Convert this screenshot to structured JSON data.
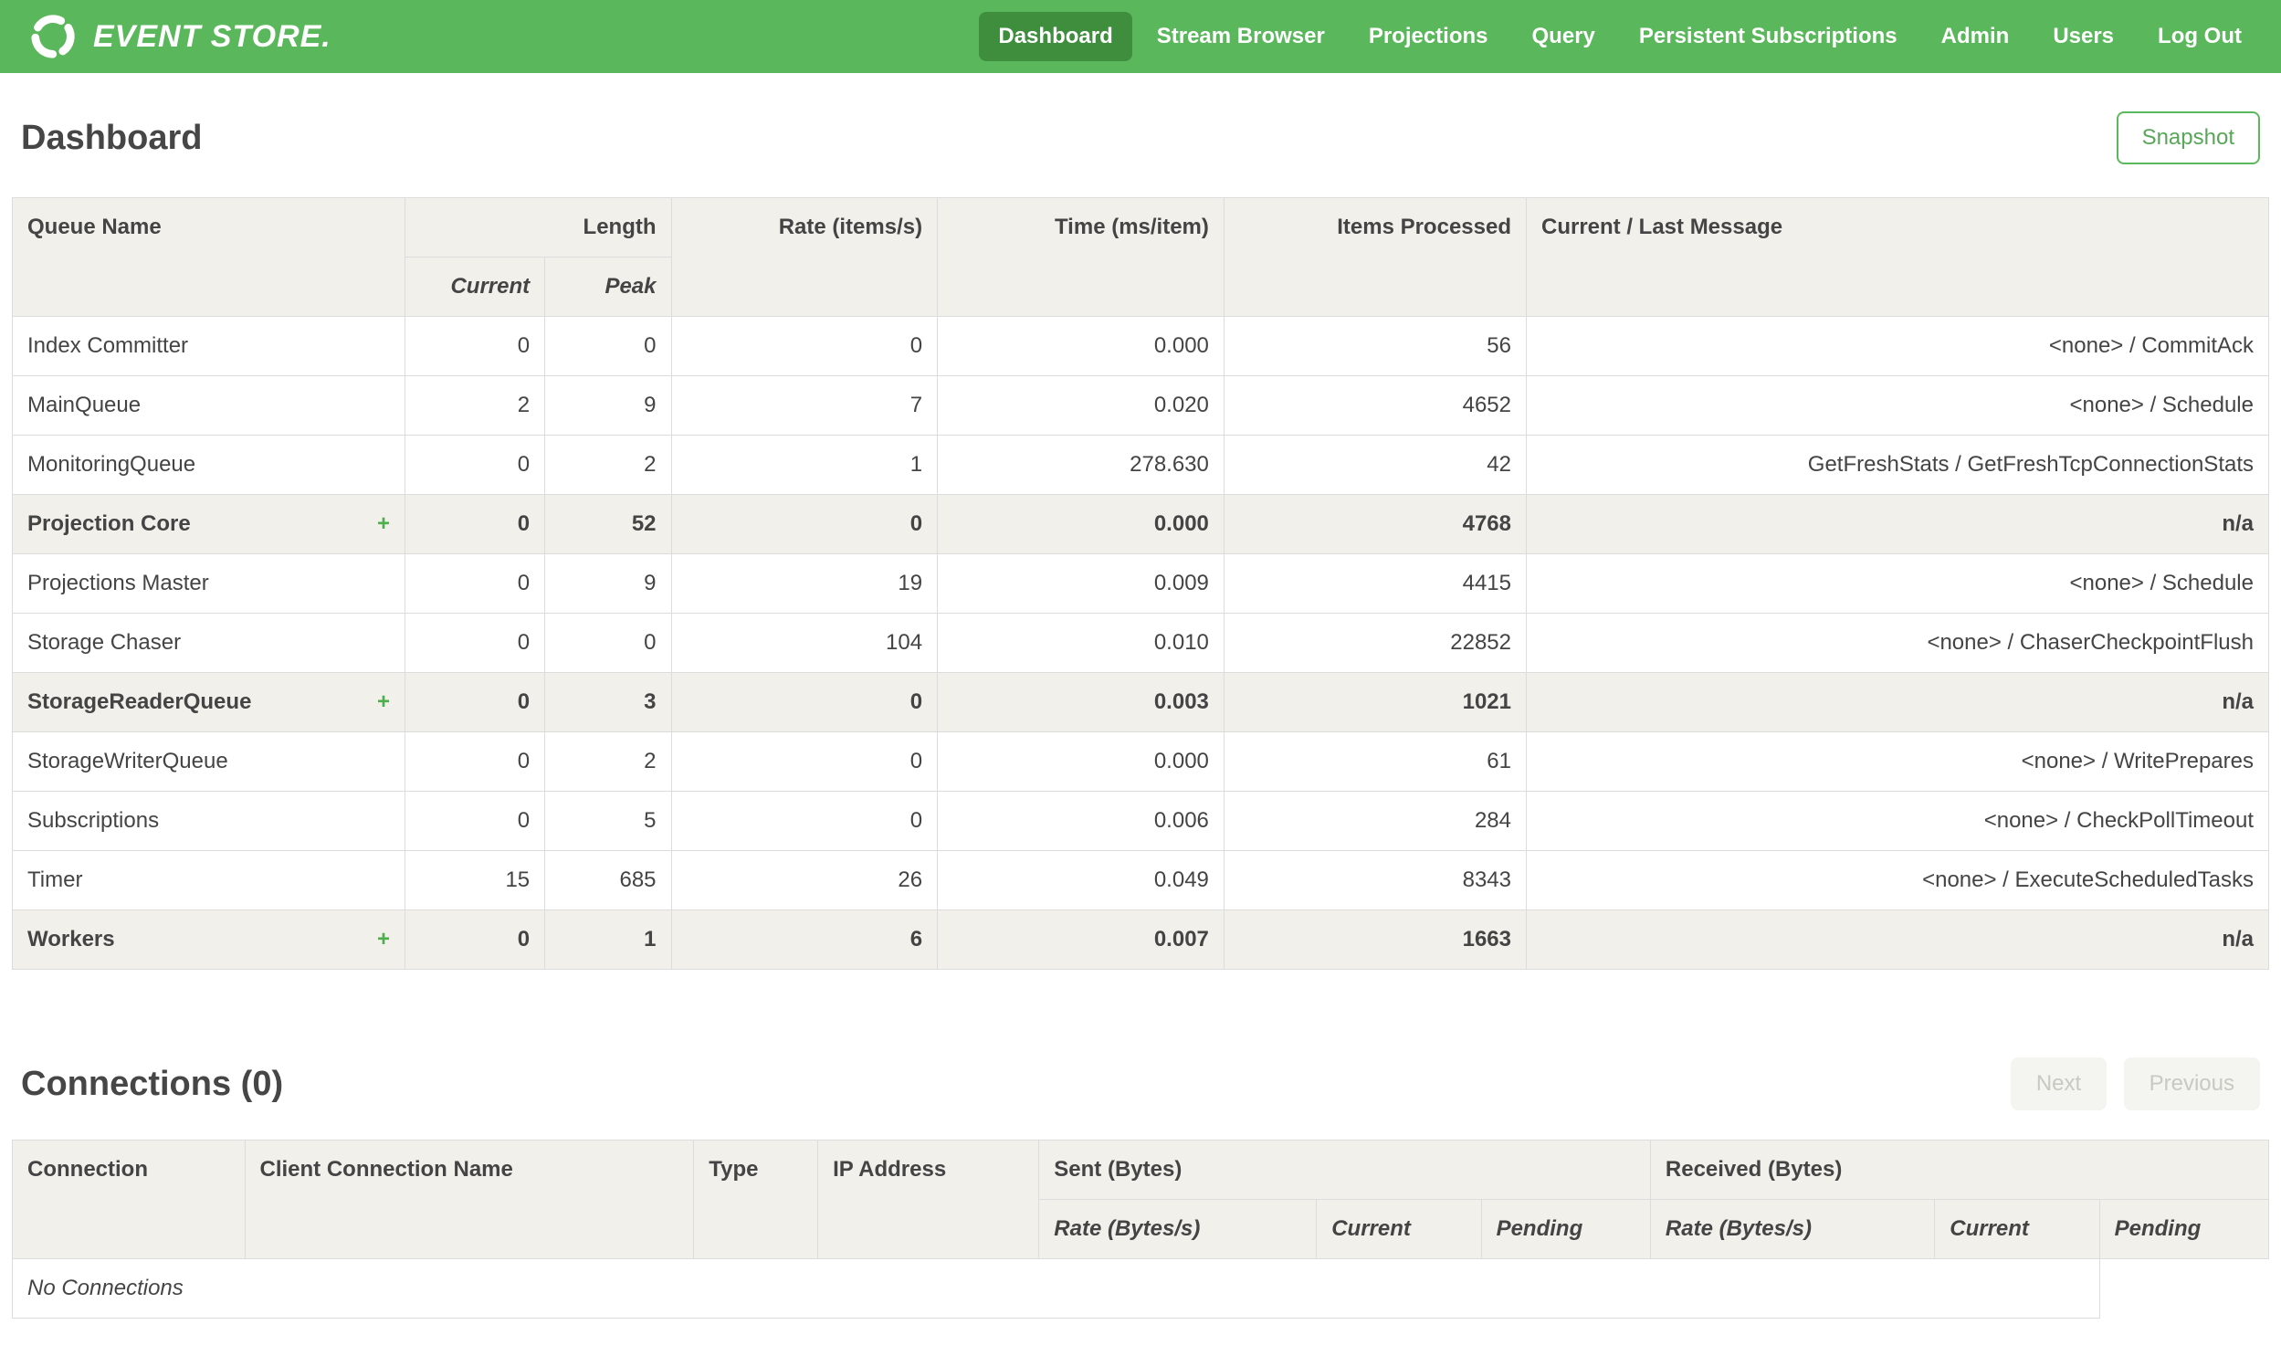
{
  "navbar": {
    "brand": "EVENT STORE.",
    "items": [
      {
        "label": "Dashboard",
        "active": true
      },
      {
        "label": "Stream Browser",
        "active": false
      },
      {
        "label": "Projections",
        "active": false
      },
      {
        "label": "Query",
        "active": false
      },
      {
        "label": "Persistent Subscriptions",
        "active": false
      },
      {
        "label": "Admin",
        "active": false
      },
      {
        "label": "Users",
        "active": false
      },
      {
        "label": "Log Out",
        "active": false
      }
    ]
  },
  "page": {
    "title": "Dashboard",
    "snapshot_button": "Snapshot"
  },
  "queues": {
    "headers": {
      "queue_name": "Queue Name",
      "length": "Length",
      "current": "Current",
      "peak": "Peak",
      "rate": "Rate (items/s)",
      "time": "Time (ms/item)",
      "items_processed": "Items Processed",
      "message": "Current / Last Message"
    },
    "rows": [
      {
        "name": "Index Committer",
        "expandable": false,
        "current": "0",
        "peak": "0",
        "rate": "0",
        "time": "0.000",
        "items_processed": "56",
        "message": "<none> / CommitAck"
      },
      {
        "name": "MainQueue",
        "expandable": false,
        "current": "2",
        "peak": "9",
        "rate": "7",
        "time": "0.020",
        "items_processed": "4652",
        "message": "<none> / Schedule"
      },
      {
        "name": "MonitoringQueue",
        "expandable": false,
        "current": "0",
        "peak": "2",
        "rate": "1",
        "time": "278.630",
        "items_processed": "42",
        "message": "GetFreshStats / GetFreshTcpConnectionStats"
      },
      {
        "name": "Projection Core",
        "expandable": true,
        "current": "0",
        "peak": "52",
        "rate": "0",
        "time": "0.000",
        "items_processed": "4768",
        "message": "n/a"
      },
      {
        "name": "Projections Master",
        "expandable": false,
        "current": "0",
        "peak": "9",
        "rate": "19",
        "time": "0.009",
        "items_processed": "4415",
        "message": "<none> / Schedule"
      },
      {
        "name": "Storage Chaser",
        "expandable": false,
        "current": "0",
        "peak": "0",
        "rate": "104",
        "time": "0.010",
        "items_processed": "22852",
        "message": "<none> / ChaserCheckpointFlush"
      },
      {
        "name": "StorageReaderQueue",
        "expandable": true,
        "current": "0",
        "peak": "3",
        "rate": "0",
        "time": "0.003",
        "items_processed": "1021",
        "message": "n/a"
      },
      {
        "name": "StorageWriterQueue",
        "expandable": false,
        "current": "0",
        "peak": "2",
        "rate": "0",
        "time": "0.000",
        "items_processed": "61",
        "message": "<none> / WritePrepares"
      },
      {
        "name": "Subscriptions",
        "expandable": false,
        "current": "0",
        "peak": "5",
        "rate": "0",
        "time": "0.006",
        "items_processed": "284",
        "message": "<none> / CheckPollTimeout"
      },
      {
        "name": "Timer",
        "expandable": false,
        "current": "15",
        "peak": "685",
        "rate": "26",
        "time": "0.049",
        "items_processed": "8343",
        "message": "<none> / ExecuteScheduledTasks"
      },
      {
        "name": "Workers",
        "expandable": true,
        "current": "0",
        "peak": "1",
        "rate": "6",
        "time": "0.007",
        "items_processed": "1663",
        "message": "n/a"
      }
    ]
  },
  "connections": {
    "title": "Connections (0)",
    "next_button": "Next",
    "previous_button": "Previous",
    "headers": {
      "connection": "Connection",
      "client_connection_name": "Client Connection Name",
      "type": "Type",
      "ip_address": "IP Address",
      "sent": "Sent (Bytes)",
      "received": "Received (Bytes)",
      "rate": "Rate (Bytes/s)",
      "current": "Current",
      "pending": "Pending"
    },
    "empty_message": "No Connections"
  },
  "colors": {
    "navbar_green": "#5bb75b",
    "active_nav_green": "#3e8e3e",
    "accent_green": "#4cae4c",
    "header_bg": "#f1f0ea"
  }
}
